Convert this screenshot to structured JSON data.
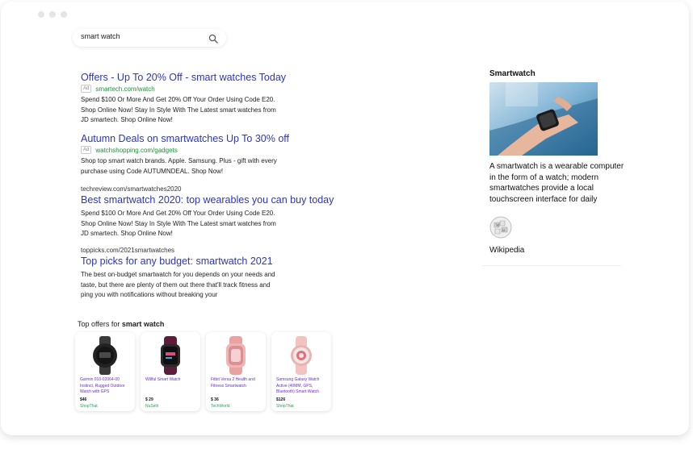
{
  "search": {
    "query": "smart watch"
  },
  "results": [
    {
      "type": "ad",
      "title": "Offers - Up To 20% Off - smart watches Today",
      "badge": "Ad",
      "url": "smartech.com/watch",
      "desc": "Spend $100 Or More And Get 20% Off Your Order Using Code E20. Shop Online Now! Stay In Style With The Latest smart watches from JD smartech. Shop Online Now!"
    },
    {
      "type": "ad",
      "title": "Autumn Deals on smartwatches Up To 30% off",
      "badge": "Ad",
      "url": "watchshopping.com/gadgets",
      "desc": "Shop top smart watch brands. Apple. Samsung. Plus - gift with every purchase using Code AUTUMNDEAL. Shop Now!"
    },
    {
      "type": "organic",
      "url": "techreview.com/smartwatches2020",
      "title": "Best smartwatch 2020: top wearables you can buy today",
      "desc": "Spend $100 Or More And Get 20% Off Your Order Using Code E20. Shop Online Now! Stay In Style With The Latest smart watches from JD smartech. Shop Online Now!"
    },
    {
      "type": "organic",
      "url": "toppicks.com/2021smartwatches",
      "title": "Top picks for any budget: smartwatch 2021",
      "desc": "The best on-budget smartwatch for you depends on your needs and taste, but there are plenty of them out there that'll track fitness and ping you with notifications without breaking your"
    }
  ],
  "offers": {
    "title_prefix": "Top offers for ",
    "title_query": "smart watch",
    "items": [
      {
        "name": "Garmin 010-02064-00 Instinct, Rugged Outdoor Watch with GPS",
        "price": "$46",
        "shop": "ShopThat",
        "band": "#3a3a3a",
        "face": "#151515"
      },
      {
        "name": "Willful Smart Watch",
        "price": "$ 29",
        "shop": "NuSellr",
        "band": "#5b1d3a",
        "face": "#101010"
      },
      {
        "name": "Fitbit Versa 2 Health and Fitness Smartwatch",
        "price": "$ 36",
        "shop": "TechWorld",
        "band": "#e9a2a2",
        "face": "#f0b6b6"
      },
      {
        "name": "Samsung Galaxy Watch Active (40MM, GPS, Bluetooth) Smart Watch",
        "price": "$126",
        "shop": "ShopThat",
        "band": "#f2c3c0",
        "face": "#e8b4b2"
      }
    ]
  },
  "knowledge": {
    "title": "Smartwatch",
    "description": "A smartwatch is a wearable computer in the form of a watch; modern smartwatches provide a local touchscreen interface for daily",
    "source": "Wikipedia"
  },
  "colors": {
    "link": "#2a35c9",
    "url_green": "#1f8e3a",
    "product_name": "#6a2bd6",
    "shop_green": "#2f9a5b"
  }
}
